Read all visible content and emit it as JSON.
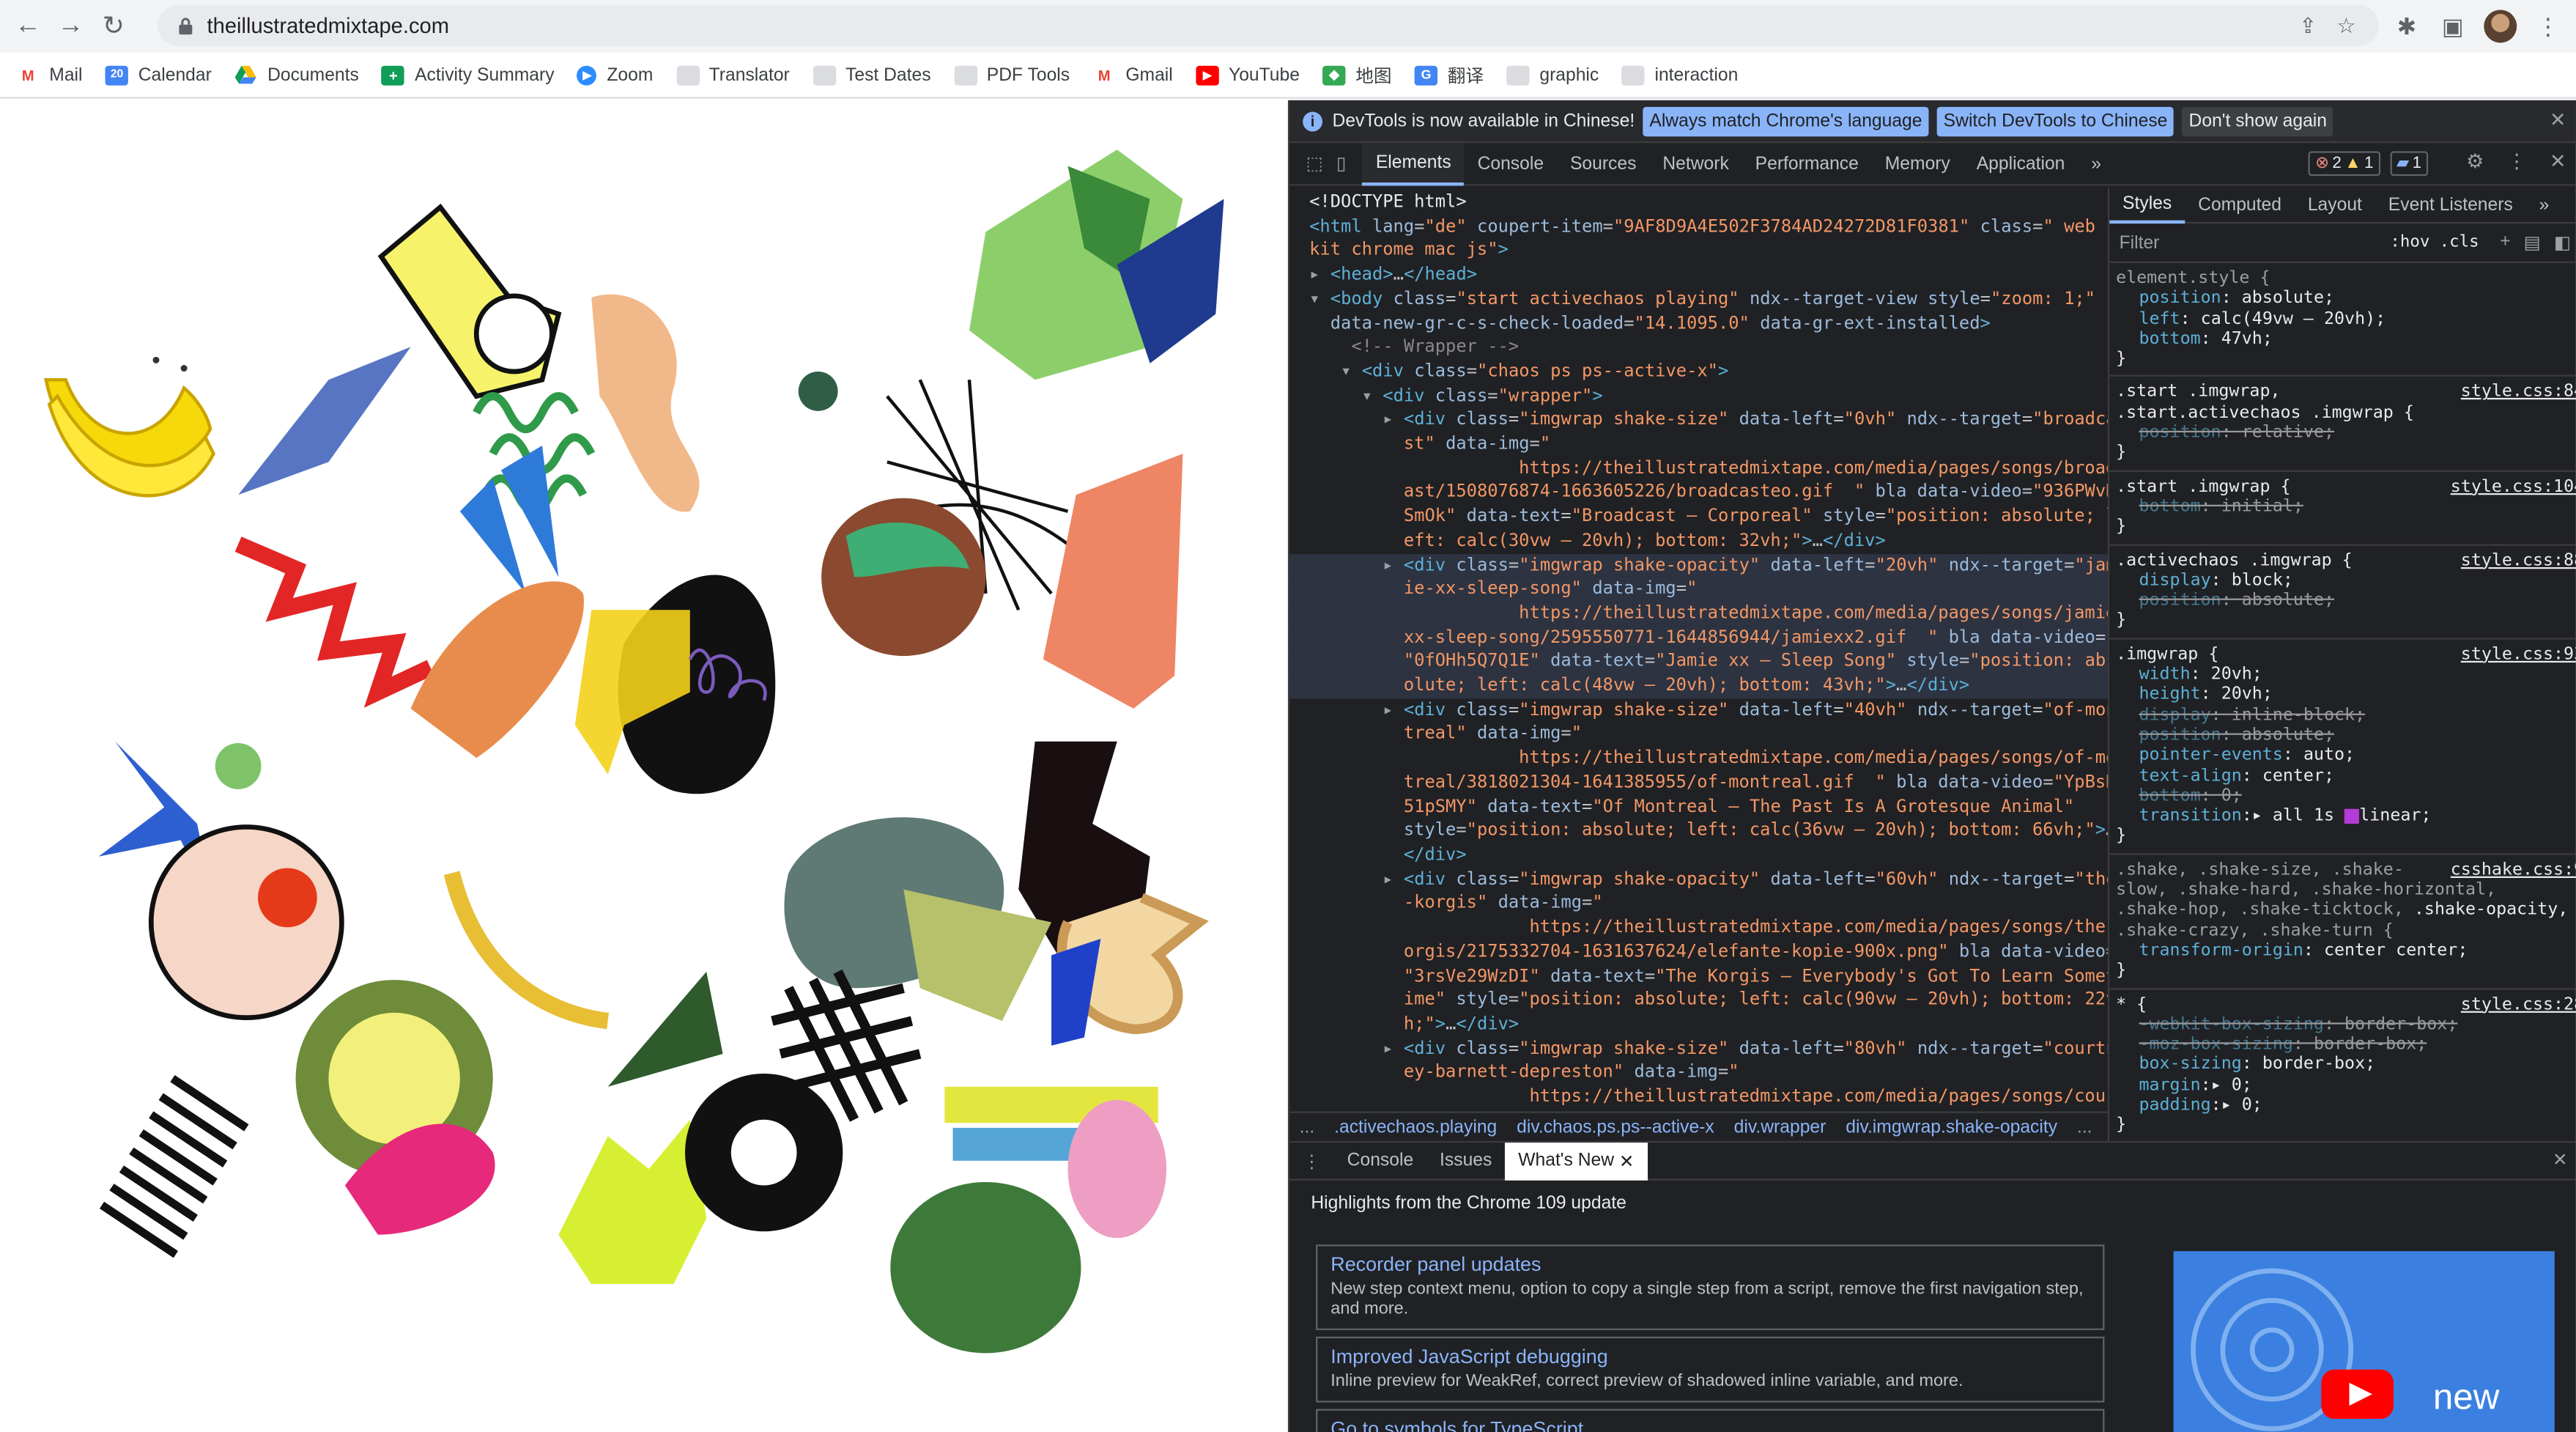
{
  "browser": {
    "url": "theillustratedmixtape.com",
    "bookmarks": [
      {
        "label": "Mail",
        "icon": "gmail-icon"
      },
      {
        "label": "Calendar",
        "icon": "calendar-icon"
      },
      {
        "label": "Documents",
        "icon": "drive-icon"
      },
      {
        "label": "Activity Summary",
        "icon": "plus-icon"
      },
      {
        "label": "Zoom",
        "icon": "zoom-icon"
      },
      {
        "label": "Translator",
        "icon": "folder-icon"
      },
      {
        "label": "Test Dates",
        "icon": "folder-icon"
      },
      {
        "label": "PDF Tools",
        "icon": "folder-icon"
      },
      {
        "label": "Gmail",
        "icon": "gmail-icon"
      },
      {
        "label": "YouTube",
        "icon": "youtube-icon"
      },
      {
        "label": "地图",
        "icon": "maps-icon"
      },
      {
        "label": "翻译",
        "icon": "translate-icon"
      },
      {
        "label": "graphic",
        "icon": "folder-icon"
      },
      {
        "label": "interaction",
        "icon": "folder-icon"
      }
    ]
  },
  "devtools": {
    "infobar": {
      "message": "DevTools is now available in Chinese!",
      "btn_match": "Always match Chrome's language",
      "btn_switch": "Switch DevTools to Chinese",
      "btn_dont": "Don't show again"
    },
    "tabs": [
      "Elements",
      "Console",
      "Sources",
      "Network",
      "Performance",
      "Memory",
      "Application"
    ],
    "errors": "2",
    "warnings": "1",
    "messages": "1",
    "style_tabs": [
      "Styles",
      "Computed",
      "Layout",
      "Event Listeners"
    ],
    "filter_placeholder": "Filter",
    "hov": ":hov",
    "cls": ".cls",
    "breadcrumbs": [
      "...",
      ".activechaos.playing",
      "div.chaos.ps.ps--active-x",
      "div.wrapper",
      "div.imgwrap.shake-opacity",
      "..."
    ],
    "drawer_tabs": [
      "Console",
      "Issues",
      "What's New"
    ],
    "whats_new_heading": "Highlights from the Chrome 109 update",
    "cards": [
      {
        "title": "Recorder panel updates",
        "desc": "New step context menu, option to copy a single step from a script, remove the first navigation step, and more."
      },
      {
        "title": "Improved JavaScript debugging",
        "desc": "Inline preview for WeakRef, correct preview of shadowed inline variable, and more."
      },
      {
        "title": "Go to symbols for TypeScript",
        "desc": ""
      }
    ],
    "video_label": "new"
  }
}
